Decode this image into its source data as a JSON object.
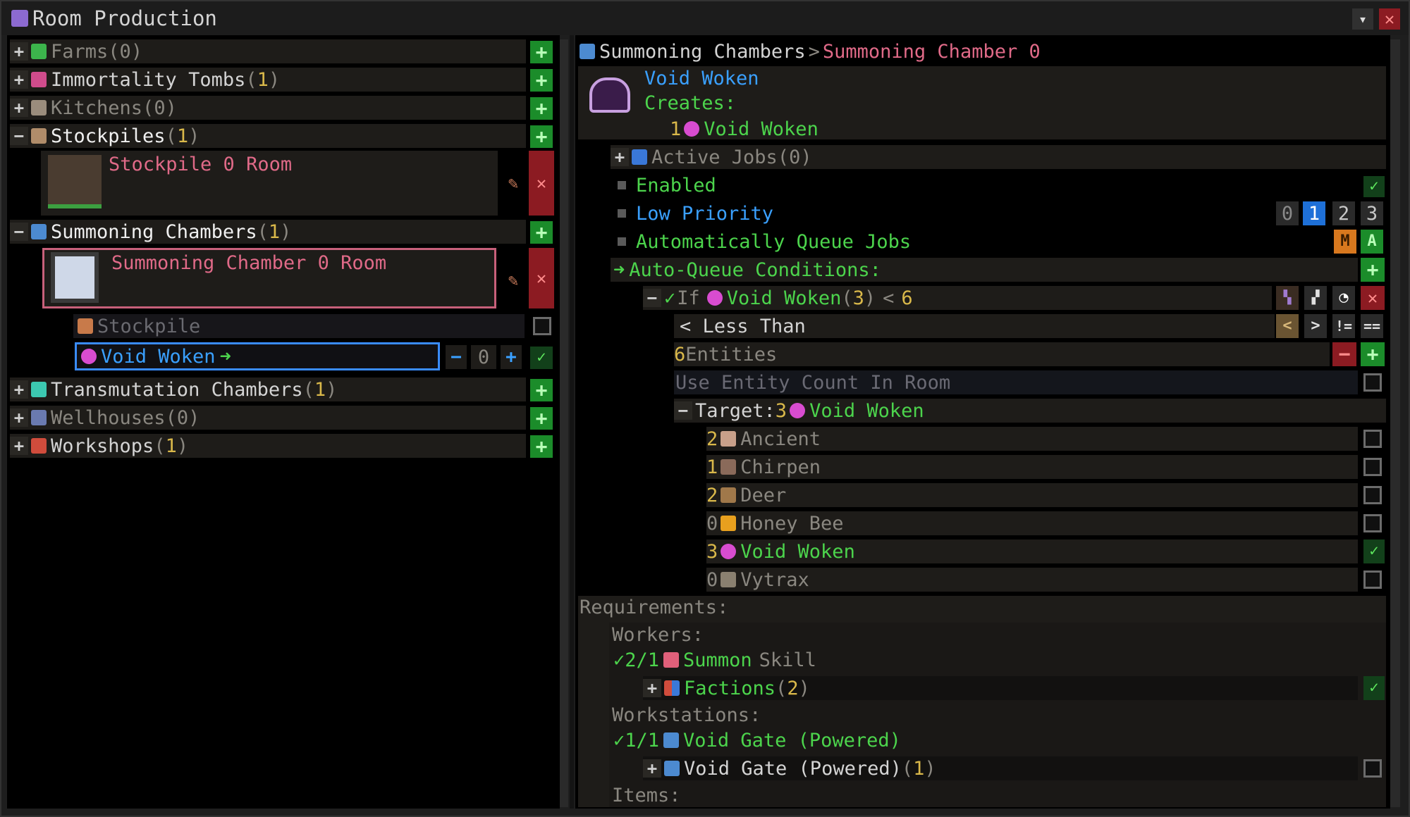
{
  "window": {
    "title": "Room Production"
  },
  "left": {
    "categories": [
      {
        "label": "Farms",
        "count": "0"
      },
      {
        "label": "Immortality Tombs",
        "count": "1"
      },
      {
        "label": "Kitchens",
        "count": "0"
      },
      {
        "label": "Stockpiles",
        "count": "1"
      },
      {
        "label": "Summoning Chambers",
        "count": "1"
      },
      {
        "label": "Transmutation Chambers",
        "count": "1"
      },
      {
        "label": "Wellhouses",
        "count": "0"
      },
      {
        "label": "Workshops",
        "count": "1"
      }
    ],
    "stockpile_room": "Stockpile 0 Room",
    "summoning_room": "Summoning Chamber 0 Room",
    "sub_stockpile": "Stockpile",
    "sub_void_woken": "Void Woken",
    "void_woken_qty": "0"
  },
  "right": {
    "breadcrumb_parent": "Summoning Chambers",
    "breadcrumb_sep": ">",
    "breadcrumb_current": "Summoning Chamber 0",
    "recipe_name": "Void Woken",
    "creates_label": "Creates:",
    "creates_qty": "1",
    "creates_item": "Void Woken",
    "active_jobs_label": "Active Jobs",
    "active_jobs_count": "0",
    "enabled_label": "Enabled",
    "low_priority_label": "Low Priority",
    "priority_options": [
      "0",
      "1",
      "2",
      "3"
    ],
    "auto_queue_label": "Automatically Queue Jobs",
    "auto_queue_conditions_label": "Auto-Queue Conditions:",
    "cond_if": "If",
    "cond_item": "Void Woken",
    "cond_count": "3",
    "cond_op": "<",
    "cond_value": "6",
    "less_than_label": "< Less Than",
    "entities_num": "6",
    "entities_label": "Entities",
    "use_entity_count_label": "Use Entity Count In Room",
    "target_label": "Target:",
    "target_num": "3",
    "target_item": "Void Woken",
    "targets": [
      {
        "num": "2",
        "name": "Ancient",
        "checked": false
      },
      {
        "num": "1",
        "name": "Chirpen",
        "checked": false
      },
      {
        "num": "2",
        "name": "Deer",
        "checked": false
      },
      {
        "num": "0",
        "name": "Honey Bee",
        "checked": false
      },
      {
        "num": "3",
        "name": "Void Woken",
        "checked": true
      },
      {
        "num": "0",
        "name": "Vytrax",
        "checked": false
      }
    ],
    "requirements_label": "Requirements:",
    "workers_label": "Workers:",
    "worker_req": "2/1",
    "skill_name": "Summon",
    "skill_suffix": "Skill",
    "factions_label": "Factions",
    "factions_count": "2",
    "workstations_label": "Workstations:",
    "ws_req": "1/1",
    "ws_name": "Void Gate (Powered)",
    "ws_sub_name": "Void Gate (Powered)",
    "ws_sub_count": "1",
    "items_label": "Items:"
  },
  "colors": {
    "green": "#4cd44c",
    "blue": "#3aa0ff",
    "pink": "#e06a88",
    "gold": "#d9b84a"
  }
}
